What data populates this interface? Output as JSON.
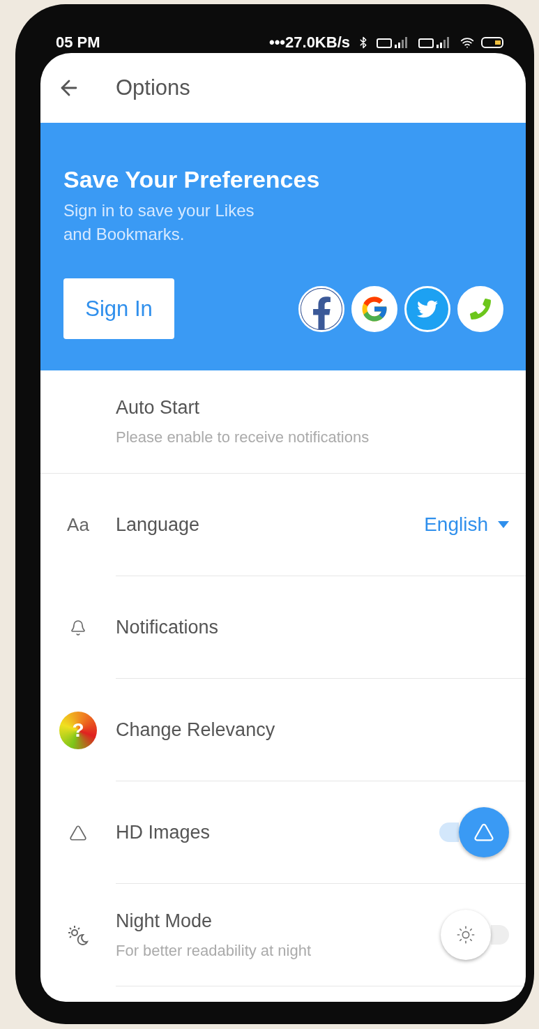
{
  "status_bar": {
    "time": "05 PM",
    "network_speed": "•••27.0KB/s"
  },
  "header": {
    "title": "Options"
  },
  "banner": {
    "title": "Save Your Preferences",
    "subtitle": "Sign in to save your Likes and Bookmarks.",
    "button": "Sign In"
  },
  "settings": [
    {
      "kind": "plain",
      "label": "Auto Start",
      "subtitle": "Please enable to receive notifications"
    },
    {
      "kind": "dropdown",
      "icon_text": "Aa",
      "label": "Language",
      "value": "English"
    },
    {
      "kind": "plain",
      "label": "Notifications"
    },
    {
      "kind": "plain",
      "icon_text": "?",
      "label": "Change Relevancy"
    },
    {
      "kind": "toggle",
      "label": "HD Images",
      "on": true
    },
    {
      "kind": "toggle",
      "label": "Night Mode",
      "subtitle": "For better readability at night",
      "on": false
    }
  ]
}
